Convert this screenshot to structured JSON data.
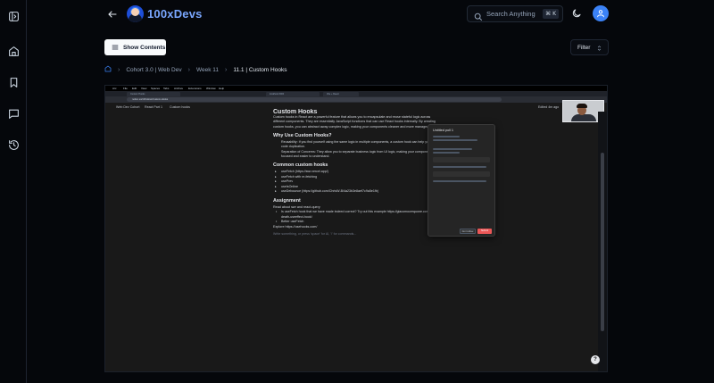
{
  "app": {
    "brand": "100xDevs"
  },
  "sidebar": {
    "icons": [
      {
        "name": "sidebar-toggle-icon"
      },
      {
        "name": "home-icon"
      },
      {
        "name": "bookmark-icon"
      },
      {
        "name": "message-icon"
      },
      {
        "name": "history-icon"
      }
    ]
  },
  "header": {
    "search_placeholder": "Search Anything",
    "search_shortcut": "⌘ K"
  },
  "toolbar": {
    "show_contents": "Show Contents",
    "filter": "Filter"
  },
  "breadcrumb": {
    "items": [
      "Cohort 3.0 | Web Dev",
      "Week 11",
      "11.1 | Custom Hooks"
    ]
  },
  "video": {
    "menubar": [
      "Arc",
      "File",
      "Edit",
      "View",
      "Spaces",
      "Tabs",
      "Archive",
      "Extensions",
      "Window",
      "Help"
    ],
    "tabs": [
      "Custom Hooks",
      "localhost:3000",
      "Vite + React"
    ],
    "url": "notion.so/100xdevs/Custom-Hooks",
    "notion_crumbs": [
      "Web Dev Cohort",
      "React Part 1",
      "Custom hooks"
    ],
    "edited": "Edited 4m ago",
    "doc": {
      "title": "Custom Hooks",
      "intro": "Custom hooks in React are a powerful feature that allows you to encapsulate and reuse stateful logic across different components. They are essentially JavaScript functions that can use React hooks internally. By creating custom hooks, you can abstract away complex logic, making your components cleaner and more manageable.",
      "h_why": "Why Use Custom Hooks?",
      "why_items": [
        "Reusability: If you find yourself using the same logic in multiple components, a custom hook can help you avoid code duplication.",
        "Separation of Concerns: They allow you to separate business logic from UI logic, making your components more focused and easier to understand."
      ],
      "h_common": "Common custom hooks",
      "common_items": [
        "useFetch (https://swr.vercel.app/)",
        "useFetch with re-fetching",
        "usePrev",
        "useIsOnline",
        "useDebounce (https://github.com/ChrisW-B/4a23b3e8aef7c9a5e1fb)"
      ],
      "h_assignment": "Assignment",
      "assign_intro": "Read about swr and react-query",
      "assign_items": [
        "Is useFetch hook that we have made indeed correct? Try out this example https://giacomocerquone.com/blog/life-death-useeffect-hook/",
        "Better useFetch"
      ],
      "explore": "Explore https://usehooks.com/",
      "placeholder": "Write something, or press 'space' for AI, '/' for commands..."
    },
    "dialog": {
      "title": "Untitled poll 1",
      "cancel": "Don't Allow",
      "confirm": "Submit"
    },
    "help": "?"
  }
}
